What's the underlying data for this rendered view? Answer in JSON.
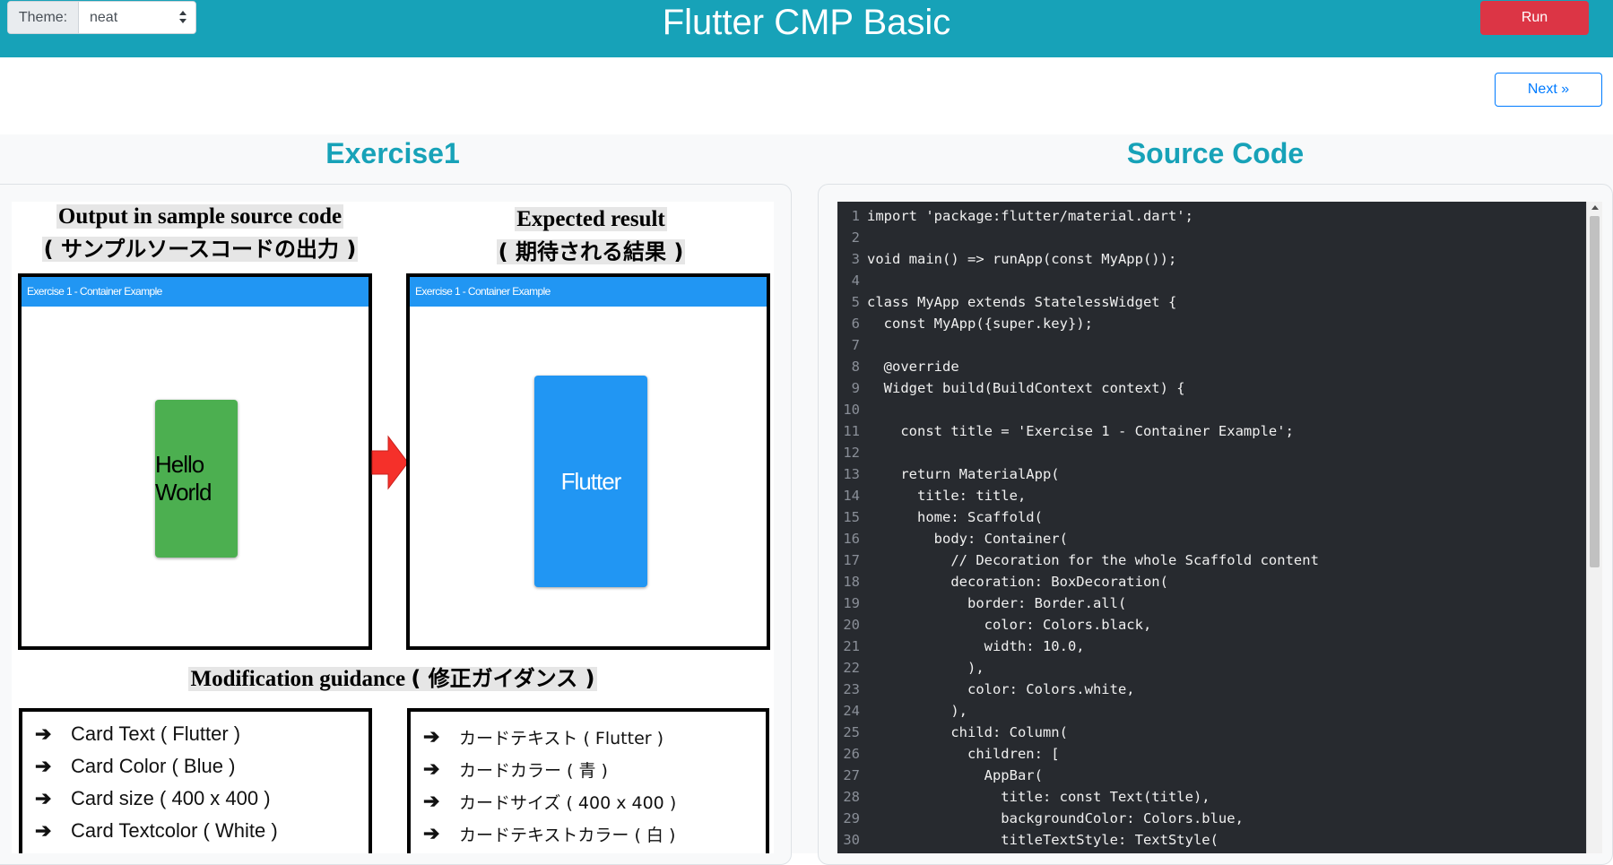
{
  "header": {
    "theme_label": "Theme:",
    "theme_value": "neat",
    "title": "Flutter CMP Basic",
    "run_label": "Run"
  },
  "nav": {
    "next_label": "Next »"
  },
  "left": {
    "title": "Exercise1",
    "output_heading": "Output in sample source code",
    "output_heading_jp": "( サンプルソースコードの出力 )",
    "expected_heading": "Expected result",
    "expected_heading_jp": "( 期待される結果 )",
    "appbar_title": "Exercise 1 - Container Example",
    "sample_card_text": "Hello World",
    "expected_card_text": "Flutter",
    "guidance_heading": "Modification guidance",
    "guidance_heading_jp": "( 修正ガイダンス )",
    "guidance_en": [
      "Card Text ( Flutter )",
      "Card Color ( Blue )",
      "Card size ( 400 x 400 )",
      "Card Textcolor ( White )"
    ],
    "guidance_jp": [
      "カードテキスト ( Flutter )",
      "カードカラー ( 青 )",
      "カードサイズ ( 400 x 400 )",
      "カードテキストカラー ( 白 )"
    ],
    "bullet": "➔"
  },
  "right": {
    "title": "Source Code",
    "code_lines": [
      "import 'package:flutter/material.dart';",
      "",
      "void main() => runApp(const MyApp());",
      "",
      "class MyApp extends StatelessWidget {",
      "  const MyApp({super.key});",
      "",
      "  @override",
      "  Widget build(BuildContext context) {",
      "",
      "    const title = 'Exercise 1 - Container Example';",
      "",
      "    return MaterialApp(",
      "      title: title,",
      "      home: Scaffold(",
      "        body: Container(",
      "          // Decoration for the whole Scaffold content",
      "          decoration: BoxDecoration(",
      "            border: Border.all(",
      "              color: Colors.black,",
      "              width: 10.0,",
      "            ),",
      "            color: Colors.white,",
      "          ),",
      "          child: Column(",
      "            children: [",
      "              AppBar(",
      "                title: const Text(title),",
      "                backgroundColor: Colors.blue,",
      "                titleTextStyle: TextStyle("
    ]
  },
  "colors": {
    "header_bg": "#17a2b8",
    "run_bg": "#dc3545",
    "card_green": "#4caf50",
    "card_blue": "#2196f3",
    "arrow_red": "#f5302a",
    "editor_bg": "#272a2f"
  }
}
